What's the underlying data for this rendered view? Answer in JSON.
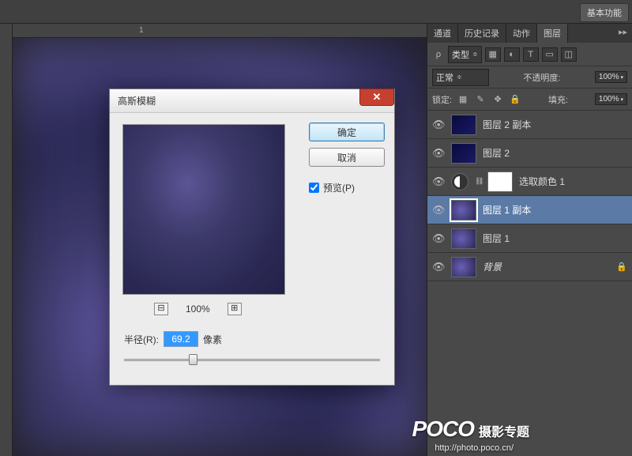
{
  "topbar": {
    "basic_btn": "基本功能"
  },
  "ruler": {
    "mark1": "1"
  },
  "panel": {
    "tabs": [
      "通道",
      "历史记录",
      "动作",
      "图层"
    ],
    "more": "▸▸",
    "filter": {
      "kind": "类型",
      "chev": "≑"
    },
    "blend": {
      "mode": "正常",
      "opacity_label": "不透明度:",
      "opacity": "100%"
    },
    "lock": {
      "label": "锁定:",
      "fill_label": "填充:",
      "fill": "100%"
    }
  },
  "layers": [
    {
      "name": "图层 2 副本",
      "kind": "dark"
    },
    {
      "name": "图层 2",
      "kind": "dark"
    },
    {
      "name": "选取颜色 1",
      "kind": "adjust"
    },
    {
      "name": "图层 1 副本",
      "kind": "canvas",
      "selected": true
    },
    {
      "name": "图层 1",
      "kind": "canvas"
    },
    {
      "name": "背景",
      "kind": "canvas",
      "bg": true,
      "locked": true
    }
  ],
  "dialog": {
    "title": "高斯模糊",
    "ok": "确定",
    "cancel": "取消",
    "preview": "预览(P)",
    "zoom": "100%",
    "radius_label": "半径(R):",
    "radius_value": "69.2",
    "radius_unit": "像素"
  },
  "watermark": {
    "brand": "POCO",
    "sub": "摄影专题",
    "url": "http://photo.poco.cn/"
  }
}
